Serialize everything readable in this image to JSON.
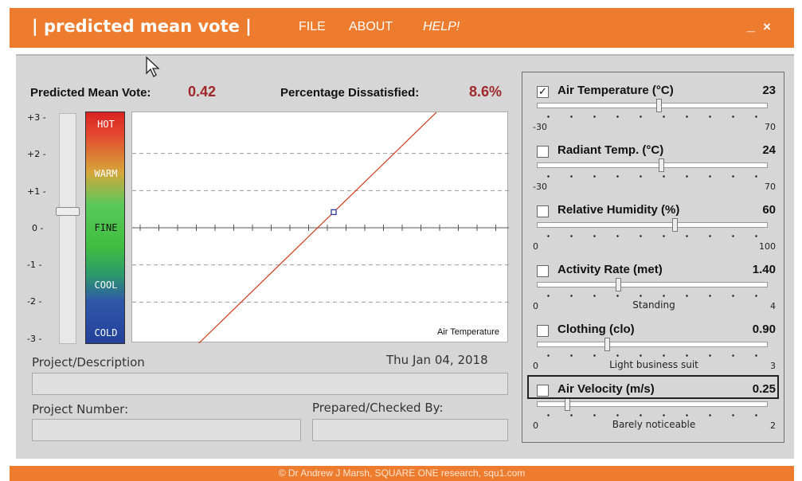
{
  "titlebar": {
    "title": "| predicted mean vote |",
    "menu": [
      "FILE",
      "ABOUT",
      "HELP!"
    ],
    "minimize": "_",
    "close": "×"
  },
  "results": {
    "pmv_label": "Predicted Mean Vote:",
    "pmv_value": "0.42",
    "ppd_label": "Percentage Dissatisfied:",
    "ppd_value": "8.6%"
  },
  "scale": {
    "labels": [
      "+3 -",
      "+2 -",
      "+1 -",
      "0 -",
      "-1 -",
      "-2 -",
      "-3 -"
    ],
    "comfort_labels": [
      "HOT",
      "WARM",
      "FINE",
      "COOL",
      "COLD"
    ]
  },
  "chart_data": {
    "type": "line",
    "xlabel": "Air Temperature",
    "ylim": [
      -3,
      3
    ],
    "xlim": [
      -30,
      70
    ],
    "grid": true,
    "current_point": {
      "x": 23,
      "y": 0.42
    }
  },
  "project": {
    "description_label": "Project/Description",
    "date": "Thu Jan 04, 2018",
    "number_label": "Project Number:",
    "prepared_label": "Prepared/Checked By:",
    "description_value": "",
    "number_value": "",
    "prepared_value": ""
  },
  "params": [
    {
      "label": "Air Temperature (°C)",
      "value": "23",
      "checked": true,
      "min": "-30",
      "max": "70",
      "mid": "",
      "pos": 0.53
    },
    {
      "label": "Radiant Temp. (°C)",
      "value": "24",
      "checked": false,
      "min": "-30",
      "max": "70",
      "mid": "",
      "pos": 0.54
    },
    {
      "label": "Relative Humidity (%)",
      "value": "60",
      "checked": false,
      "min": "0",
      "max": "100",
      "mid": "",
      "pos": 0.6
    },
    {
      "label": "Activity Rate (met)",
      "value": "1.40",
      "checked": false,
      "min": "0",
      "max": "4",
      "mid": "Standing",
      "pos": 0.35
    },
    {
      "label": "Clothing (clo)",
      "value": "0.90",
      "checked": false,
      "min": "0",
      "max": "3",
      "mid": "Light business suit",
      "pos": 0.3
    },
    {
      "label": "Air Velocity (m/s)",
      "value": "0.25",
      "checked": false,
      "min": "0",
      "max": "2",
      "mid": "Barely noticeable",
      "pos": 0.125
    }
  ],
  "footer": {
    "text": "© Dr Andrew J Marsh, SQUARE ONE research, squ1.com"
  }
}
